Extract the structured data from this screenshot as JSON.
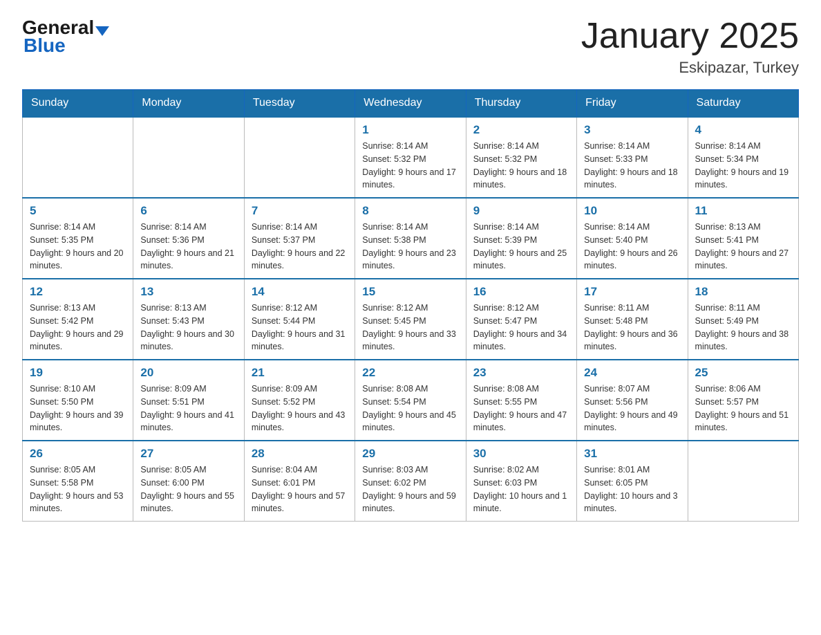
{
  "header": {
    "logo_general": "General",
    "logo_blue": "Blue",
    "title": "January 2025",
    "subtitle": "Eskipazar, Turkey"
  },
  "weekdays": [
    "Sunday",
    "Monday",
    "Tuesday",
    "Wednesday",
    "Thursday",
    "Friday",
    "Saturday"
  ],
  "weeks": [
    [
      {
        "day": "",
        "sunrise": "",
        "sunset": "",
        "daylight": ""
      },
      {
        "day": "",
        "sunrise": "",
        "sunset": "",
        "daylight": ""
      },
      {
        "day": "",
        "sunrise": "",
        "sunset": "",
        "daylight": ""
      },
      {
        "day": "1",
        "sunrise": "Sunrise: 8:14 AM",
        "sunset": "Sunset: 5:32 PM",
        "daylight": "Daylight: 9 hours and 17 minutes."
      },
      {
        "day": "2",
        "sunrise": "Sunrise: 8:14 AM",
        "sunset": "Sunset: 5:32 PM",
        "daylight": "Daylight: 9 hours and 18 minutes."
      },
      {
        "day": "3",
        "sunrise": "Sunrise: 8:14 AM",
        "sunset": "Sunset: 5:33 PM",
        "daylight": "Daylight: 9 hours and 18 minutes."
      },
      {
        "day": "4",
        "sunrise": "Sunrise: 8:14 AM",
        "sunset": "Sunset: 5:34 PM",
        "daylight": "Daylight: 9 hours and 19 minutes."
      }
    ],
    [
      {
        "day": "5",
        "sunrise": "Sunrise: 8:14 AM",
        "sunset": "Sunset: 5:35 PM",
        "daylight": "Daylight: 9 hours and 20 minutes."
      },
      {
        "day": "6",
        "sunrise": "Sunrise: 8:14 AM",
        "sunset": "Sunset: 5:36 PM",
        "daylight": "Daylight: 9 hours and 21 minutes."
      },
      {
        "day": "7",
        "sunrise": "Sunrise: 8:14 AM",
        "sunset": "Sunset: 5:37 PM",
        "daylight": "Daylight: 9 hours and 22 minutes."
      },
      {
        "day": "8",
        "sunrise": "Sunrise: 8:14 AM",
        "sunset": "Sunset: 5:38 PM",
        "daylight": "Daylight: 9 hours and 23 minutes."
      },
      {
        "day": "9",
        "sunrise": "Sunrise: 8:14 AM",
        "sunset": "Sunset: 5:39 PM",
        "daylight": "Daylight: 9 hours and 25 minutes."
      },
      {
        "day": "10",
        "sunrise": "Sunrise: 8:14 AM",
        "sunset": "Sunset: 5:40 PM",
        "daylight": "Daylight: 9 hours and 26 minutes."
      },
      {
        "day": "11",
        "sunrise": "Sunrise: 8:13 AM",
        "sunset": "Sunset: 5:41 PM",
        "daylight": "Daylight: 9 hours and 27 minutes."
      }
    ],
    [
      {
        "day": "12",
        "sunrise": "Sunrise: 8:13 AM",
        "sunset": "Sunset: 5:42 PM",
        "daylight": "Daylight: 9 hours and 29 minutes."
      },
      {
        "day": "13",
        "sunrise": "Sunrise: 8:13 AM",
        "sunset": "Sunset: 5:43 PM",
        "daylight": "Daylight: 9 hours and 30 minutes."
      },
      {
        "day": "14",
        "sunrise": "Sunrise: 8:12 AM",
        "sunset": "Sunset: 5:44 PM",
        "daylight": "Daylight: 9 hours and 31 minutes."
      },
      {
        "day": "15",
        "sunrise": "Sunrise: 8:12 AM",
        "sunset": "Sunset: 5:45 PM",
        "daylight": "Daylight: 9 hours and 33 minutes."
      },
      {
        "day": "16",
        "sunrise": "Sunrise: 8:12 AM",
        "sunset": "Sunset: 5:47 PM",
        "daylight": "Daylight: 9 hours and 34 minutes."
      },
      {
        "day": "17",
        "sunrise": "Sunrise: 8:11 AM",
        "sunset": "Sunset: 5:48 PM",
        "daylight": "Daylight: 9 hours and 36 minutes."
      },
      {
        "day": "18",
        "sunrise": "Sunrise: 8:11 AM",
        "sunset": "Sunset: 5:49 PM",
        "daylight": "Daylight: 9 hours and 38 minutes."
      }
    ],
    [
      {
        "day": "19",
        "sunrise": "Sunrise: 8:10 AM",
        "sunset": "Sunset: 5:50 PM",
        "daylight": "Daylight: 9 hours and 39 minutes."
      },
      {
        "day": "20",
        "sunrise": "Sunrise: 8:09 AM",
        "sunset": "Sunset: 5:51 PM",
        "daylight": "Daylight: 9 hours and 41 minutes."
      },
      {
        "day": "21",
        "sunrise": "Sunrise: 8:09 AM",
        "sunset": "Sunset: 5:52 PM",
        "daylight": "Daylight: 9 hours and 43 minutes."
      },
      {
        "day": "22",
        "sunrise": "Sunrise: 8:08 AM",
        "sunset": "Sunset: 5:54 PM",
        "daylight": "Daylight: 9 hours and 45 minutes."
      },
      {
        "day": "23",
        "sunrise": "Sunrise: 8:08 AM",
        "sunset": "Sunset: 5:55 PM",
        "daylight": "Daylight: 9 hours and 47 minutes."
      },
      {
        "day": "24",
        "sunrise": "Sunrise: 8:07 AM",
        "sunset": "Sunset: 5:56 PM",
        "daylight": "Daylight: 9 hours and 49 minutes."
      },
      {
        "day": "25",
        "sunrise": "Sunrise: 8:06 AM",
        "sunset": "Sunset: 5:57 PM",
        "daylight": "Daylight: 9 hours and 51 minutes."
      }
    ],
    [
      {
        "day": "26",
        "sunrise": "Sunrise: 8:05 AM",
        "sunset": "Sunset: 5:58 PM",
        "daylight": "Daylight: 9 hours and 53 minutes."
      },
      {
        "day": "27",
        "sunrise": "Sunrise: 8:05 AM",
        "sunset": "Sunset: 6:00 PM",
        "daylight": "Daylight: 9 hours and 55 minutes."
      },
      {
        "day": "28",
        "sunrise": "Sunrise: 8:04 AM",
        "sunset": "Sunset: 6:01 PM",
        "daylight": "Daylight: 9 hours and 57 minutes."
      },
      {
        "day": "29",
        "sunrise": "Sunrise: 8:03 AM",
        "sunset": "Sunset: 6:02 PM",
        "daylight": "Daylight: 9 hours and 59 minutes."
      },
      {
        "day": "30",
        "sunrise": "Sunrise: 8:02 AM",
        "sunset": "Sunset: 6:03 PM",
        "daylight": "Daylight: 10 hours and 1 minute."
      },
      {
        "day": "31",
        "sunrise": "Sunrise: 8:01 AM",
        "sunset": "Sunset: 6:05 PM",
        "daylight": "Daylight: 10 hours and 3 minutes."
      },
      {
        "day": "",
        "sunrise": "",
        "sunset": "",
        "daylight": ""
      }
    ]
  ]
}
